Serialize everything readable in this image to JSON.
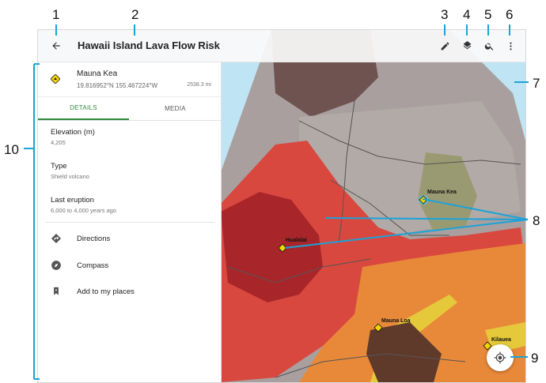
{
  "callouts": [
    "1",
    "2",
    "3",
    "4",
    "5",
    "6",
    "7",
    "8",
    "9",
    "10"
  ],
  "app": {
    "title": "Hawaii Island Lava Flow Risk"
  },
  "toolbar": {
    "back_icon": "arrow-back-icon",
    "edit_icon": "pencil-icon",
    "layers_icon": "layers-icon",
    "search_icon": "search-icon",
    "more_icon": "more-vert-icon"
  },
  "place": {
    "name": "Mauna Kea",
    "coords": "19.816952°N  155.467224°W",
    "distance": "2538.3 mi"
  },
  "tabs": [
    {
      "label": "DETAILS",
      "active": true
    },
    {
      "label": "MEDIA",
      "active": false
    }
  ],
  "attributes": [
    {
      "label": "Elevation (m)",
      "value": "4,205"
    },
    {
      "label": "Type",
      "value": "Shield volcano"
    },
    {
      "label": "Last eruption",
      "value": "6,000 to 4,000 years ago"
    }
  ],
  "actions": [
    {
      "label": "Directions",
      "icon": "directions-icon"
    },
    {
      "label": "Compass",
      "icon": "compass-icon"
    },
    {
      "label": "Add to my places",
      "icon": "bookmark-icon"
    }
  ],
  "map": {
    "markers": [
      {
        "name": "Mauna Kea",
        "selected": true
      },
      {
        "name": "Hualalai",
        "selected": false
      },
      {
        "name": "Mauna Loa",
        "selected": false
      },
      {
        "name": "Kilauea",
        "selected": false
      }
    ],
    "locate_icon": "my-location-icon",
    "colors": {
      "ocean": "#bfe4f4",
      "risk_red": "#c8403a",
      "risk_orange": "#e8893a",
      "risk_yellow": "#e6c93a",
      "land": "#a99f9f",
      "accent": "#2e8a3c",
      "callout_line": "#1aa3d9"
    }
  }
}
